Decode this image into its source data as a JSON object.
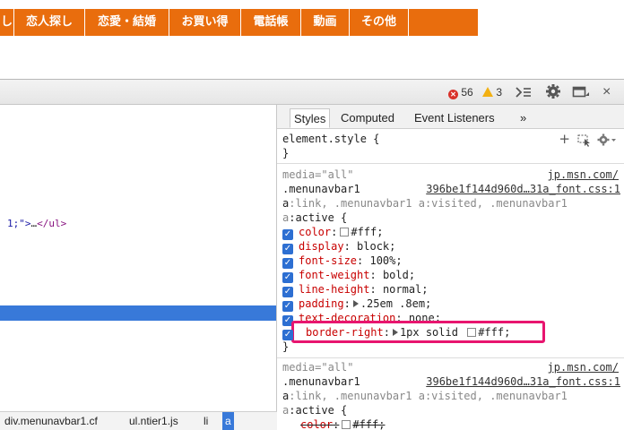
{
  "site_nav": {
    "items": [
      "し",
      "恋人探し",
      "恋愛・結婚",
      "お買い得",
      "電話帳",
      "動画",
      "その他"
    ]
  },
  "toolbar": {
    "error_count": "56",
    "warning_count": "3"
  },
  "elements": {
    "code_prefix": "1;\">",
    "code_ellipsis": "…",
    "code_close": "</ul>"
  },
  "tabs": [
    "Styles",
    "Computed",
    "Event Listeners",
    "»"
  ],
  "element_style": {
    "selector": "element.style {",
    "close": "}"
  },
  "rule1": {
    "media": "media=\"all\"",
    "source_host": "jp.msn.com/",
    "selector_main": ".menunavbar1",
    "source_file": "396be1f144d960d…31a_font.css:1",
    "selector_line2_a": "a",
    "selector_line2_b": ":link, .menunavbar1 a:visited, .menunavbar1",
    "selector_line3_a": "a",
    "selector_line3_b": ":active {",
    "properties": [
      {
        "name": "color",
        "value": "#fff;",
        "swatch": true
      },
      {
        "name": "display",
        "value": "block;"
      },
      {
        "name": "font-size",
        "value": "100%;"
      },
      {
        "name": "font-weight",
        "value": "bold;"
      },
      {
        "name": "line-height",
        "value": "normal;"
      },
      {
        "name": "padding",
        "value": ".25em .8em;",
        "expand": true
      },
      {
        "name": "text-decoration",
        "value": "none;"
      }
    ],
    "highlight": {
      "name": "border-right",
      "value_a": "1px solid",
      "value_b": "#fff;"
    },
    "close": "}"
  },
  "rule2": {
    "media": "media=\"all\"",
    "source_host": "jp.msn.com/",
    "selector_main": ".menunavbar1",
    "source_file": "396be1f144d960d…31a_font.css:1",
    "selector_line2_a": "a",
    "selector_line2_b": ":link, .menunavbar1 a:visited, .menunavbar1",
    "selector_line3_a": "a",
    "selector_line3_b": ":active {",
    "first_prop": {
      "name": "color",
      "value": "#fff;"
    }
  },
  "breadcrumbs": [
    "div.menunavbar1.cf",
    "ul.ntier1.js",
    "li",
    "a"
  ],
  "colors": {
    "nav_orange": "#e96d0d",
    "selection_blue": "#3879d9",
    "highlight_pink": "#e8156f"
  }
}
